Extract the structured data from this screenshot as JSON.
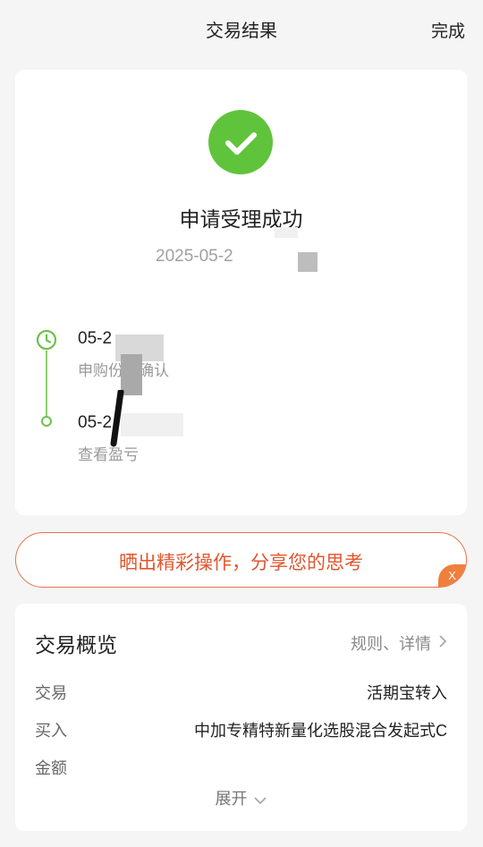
{
  "header": {
    "title": "交易结果",
    "done_label": "完成"
  },
  "result": {
    "status_icon": "check-circle-icon",
    "title": "申请受理成功",
    "time": "2025-05-2",
    "timeline": [
      {
        "date": "05-2",
        "desc": "申购份额确认"
      },
      {
        "date": "05-2",
        "desc": "查看盈亏"
      }
    ]
  },
  "share": {
    "text": "晒出精彩操作，分享您的思考",
    "close_label": "X"
  },
  "overview": {
    "title": "交易概览",
    "link_label": "规则、详情",
    "rows": [
      {
        "key": "交易",
        "value": "活期宝转入"
      },
      {
        "key": "买入",
        "value": "中加专精特新量化选股混合发起式C"
      },
      {
        "key": "金额",
        "value": ""
      }
    ],
    "expand_label": "展开"
  },
  "colors": {
    "success": "#5fc43b",
    "accent": "#e0562d",
    "timeline": "#6cc24a"
  }
}
